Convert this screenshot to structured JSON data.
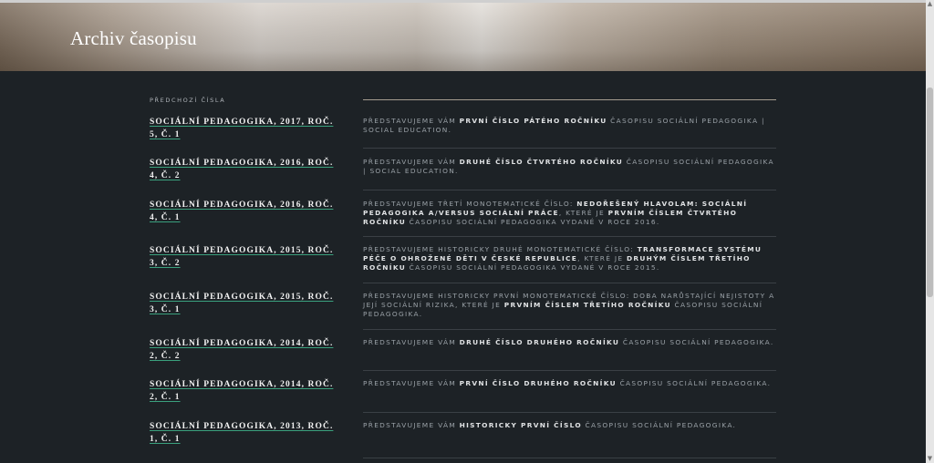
{
  "hero": {
    "title": "Archiv časopisu"
  },
  "archive": {
    "section_label": "PŘEDCHOZÍ ČÍSLA",
    "items": [
      {
        "title": "SOCIÁLNÍ PEDAGOGIKA, 2017, ROČ. 5, Č. 1",
        "desc": [
          {
            "t": "PŘEDSTAVUJEME VÁM "
          },
          {
            "t": "PRVNÍ ČÍSLO PÁTÉHO ROČNÍKU",
            "b": true
          },
          {
            "t": " ČASOPISU SOCIÁLNÍ PEDAGOGIKA | SOCIAL EDUCATION."
          }
        ]
      },
      {
        "title": "SOCIÁLNÍ PEDAGOGIKA, 2016, ROČ. 4, Č. 2",
        "desc": [
          {
            "t": "PŘEDSTAVUJEME VÁM "
          },
          {
            "t": "DRUHÉ ČÍSLO ČTVRTÉHO ROČNÍKU",
            "b": true
          },
          {
            "t": " ČASOPISU SOCIÁLNÍ PEDAGOGIKA | SOCIAL EDUCATION."
          }
        ]
      },
      {
        "title": "SOCIÁLNÍ PEDAGOGIKA, 2016, ROČ. 4, Č. 1",
        "desc": [
          {
            "t": "PŘEDSTAVUJEME TŘETÍ MONOTEMATICKÉ ČÍSLO: "
          },
          {
            "t": "NEDOŘEŠENÝ HLAVOLAM: SOCIÁLNÍ PEDAGOGIKA A/VERSUS SOCIÁLNÍ PRÁCE",
            "b": true
          },
          {
            "t": ", KTERÉ JE "
          },
          {
            "t": "PRVNÍM ČÍSLEM ČTVRTÉHO ROČNÍKU",
            "b": true
          },
          {
            "t": " ČASOPISU SOCIÁLNÍ PEDAGOGIKA VYDANÉ V ROCE 2016."
          }
        ]
      },
      {
        "title": "SOCIÁLNÍ PEDAGOGIKA, 2015, ROČ. 3, Č. 2",
        "desc": [
          {
            "t": "PŘEDSTAVUJEME HISTORICKY DRUHÉ MONOTEMATICKÉ ČÍSLO: "
          },
          {
            "t": "TRANSFORMACE SYSTÉMU PÉČE O OHROŽENÉ DĚTI V ČESKÉ REPUBLICE",
            "b": true
          },
          {
            "t": ", KTERÉ JE "
          },
          {
            "t": "DRUHÝM ČÍSLEM TŘETÍHO ROČNÍKU",
            "b": true
          },
          {
            "t": " ČASOPISU SOCIÁLNÍ PEDAGOGIKA VYDANÉ V ROCE 2015."
          }
        ]
      },
      {
        "title": "SOCIÁLNÍ PEDAGOGIKA, 2015, ROČ. 3, Č. 1",
        "desc": [
          {
            "t": "PŘEDSTAVUJEME HISTORICKY PRVNÍ MONOTEMATICKÉ ČÍSLO: DOBA NARŮSTAJÍCÍ NEJISTOTY A JEJÍ SOCIÁLNÍ RIZIKA, KTERÉ JE "
          },
          {
            "t": "PRVNÍM ČÍSLEM TŘETÍHO ROČNÍKU",
            "b": true
          },
          {
            "t": " ČASOPISU SOCIÁLNÍ PEDAGOGIKA."
          }
        ]
      },
      {
        "title": "SOCIÁLNÍ PEDAGOGIKA, 2014, ROČ. 2, Č. 2",
        "desc": [
          {
            "t": "PŘEDSTAVUJEME VÁM "
          },
          {
            "t": "DRUHÉ ČÍSLO DRUHÉHO ROČNÍKU",
            "b": true
          },
          {
            "t": " ČASOPISU SOCIÁLNÍ PEDAGOGIKA."
          }
        ]
      },
      {
        "title": "SOCIÁLNÍ PEDAGOGIKA, 2014, ROČ. 2, Č. 1",
        "desc": [
          {
            "t": "PŘEDSTAVUJEME VÁM "
          },
          {
            "t": "PRVNÍ ČÍSLO DRUHÉHO ROČNÍKU",
            "b": true
          },
          {
            "t": " ČASOPISU SOCIÁLNÍ PEDAGOGIKA."
          }
        ]
      },
      {
        "title": "SOCIÁLNÍ PEDAGOGIKA, 2013, ROČ. 1, Č. 1",
        "desc": [
          {
            "t": "PŘEDSTAVUJEME VÁM "
          },
          {
            "t": "HISTORICKY PRVNÍ ČÍSLO",
            "b": true
          },
          {
            "t": " ČASOPISU SOCIÁLNÍ PEDAGOGIKA."
          }
        ]
      }
    ]
  },
  "colors": {
    "background": "#1d2226",
    "link_underline": "#3aa07d",
    "rule": "#a59c8f"
  },
  "icons": {
    "scroll_up": "caret-up-icon",
    "scroll_down": "caret-down-icon"
  }
}
